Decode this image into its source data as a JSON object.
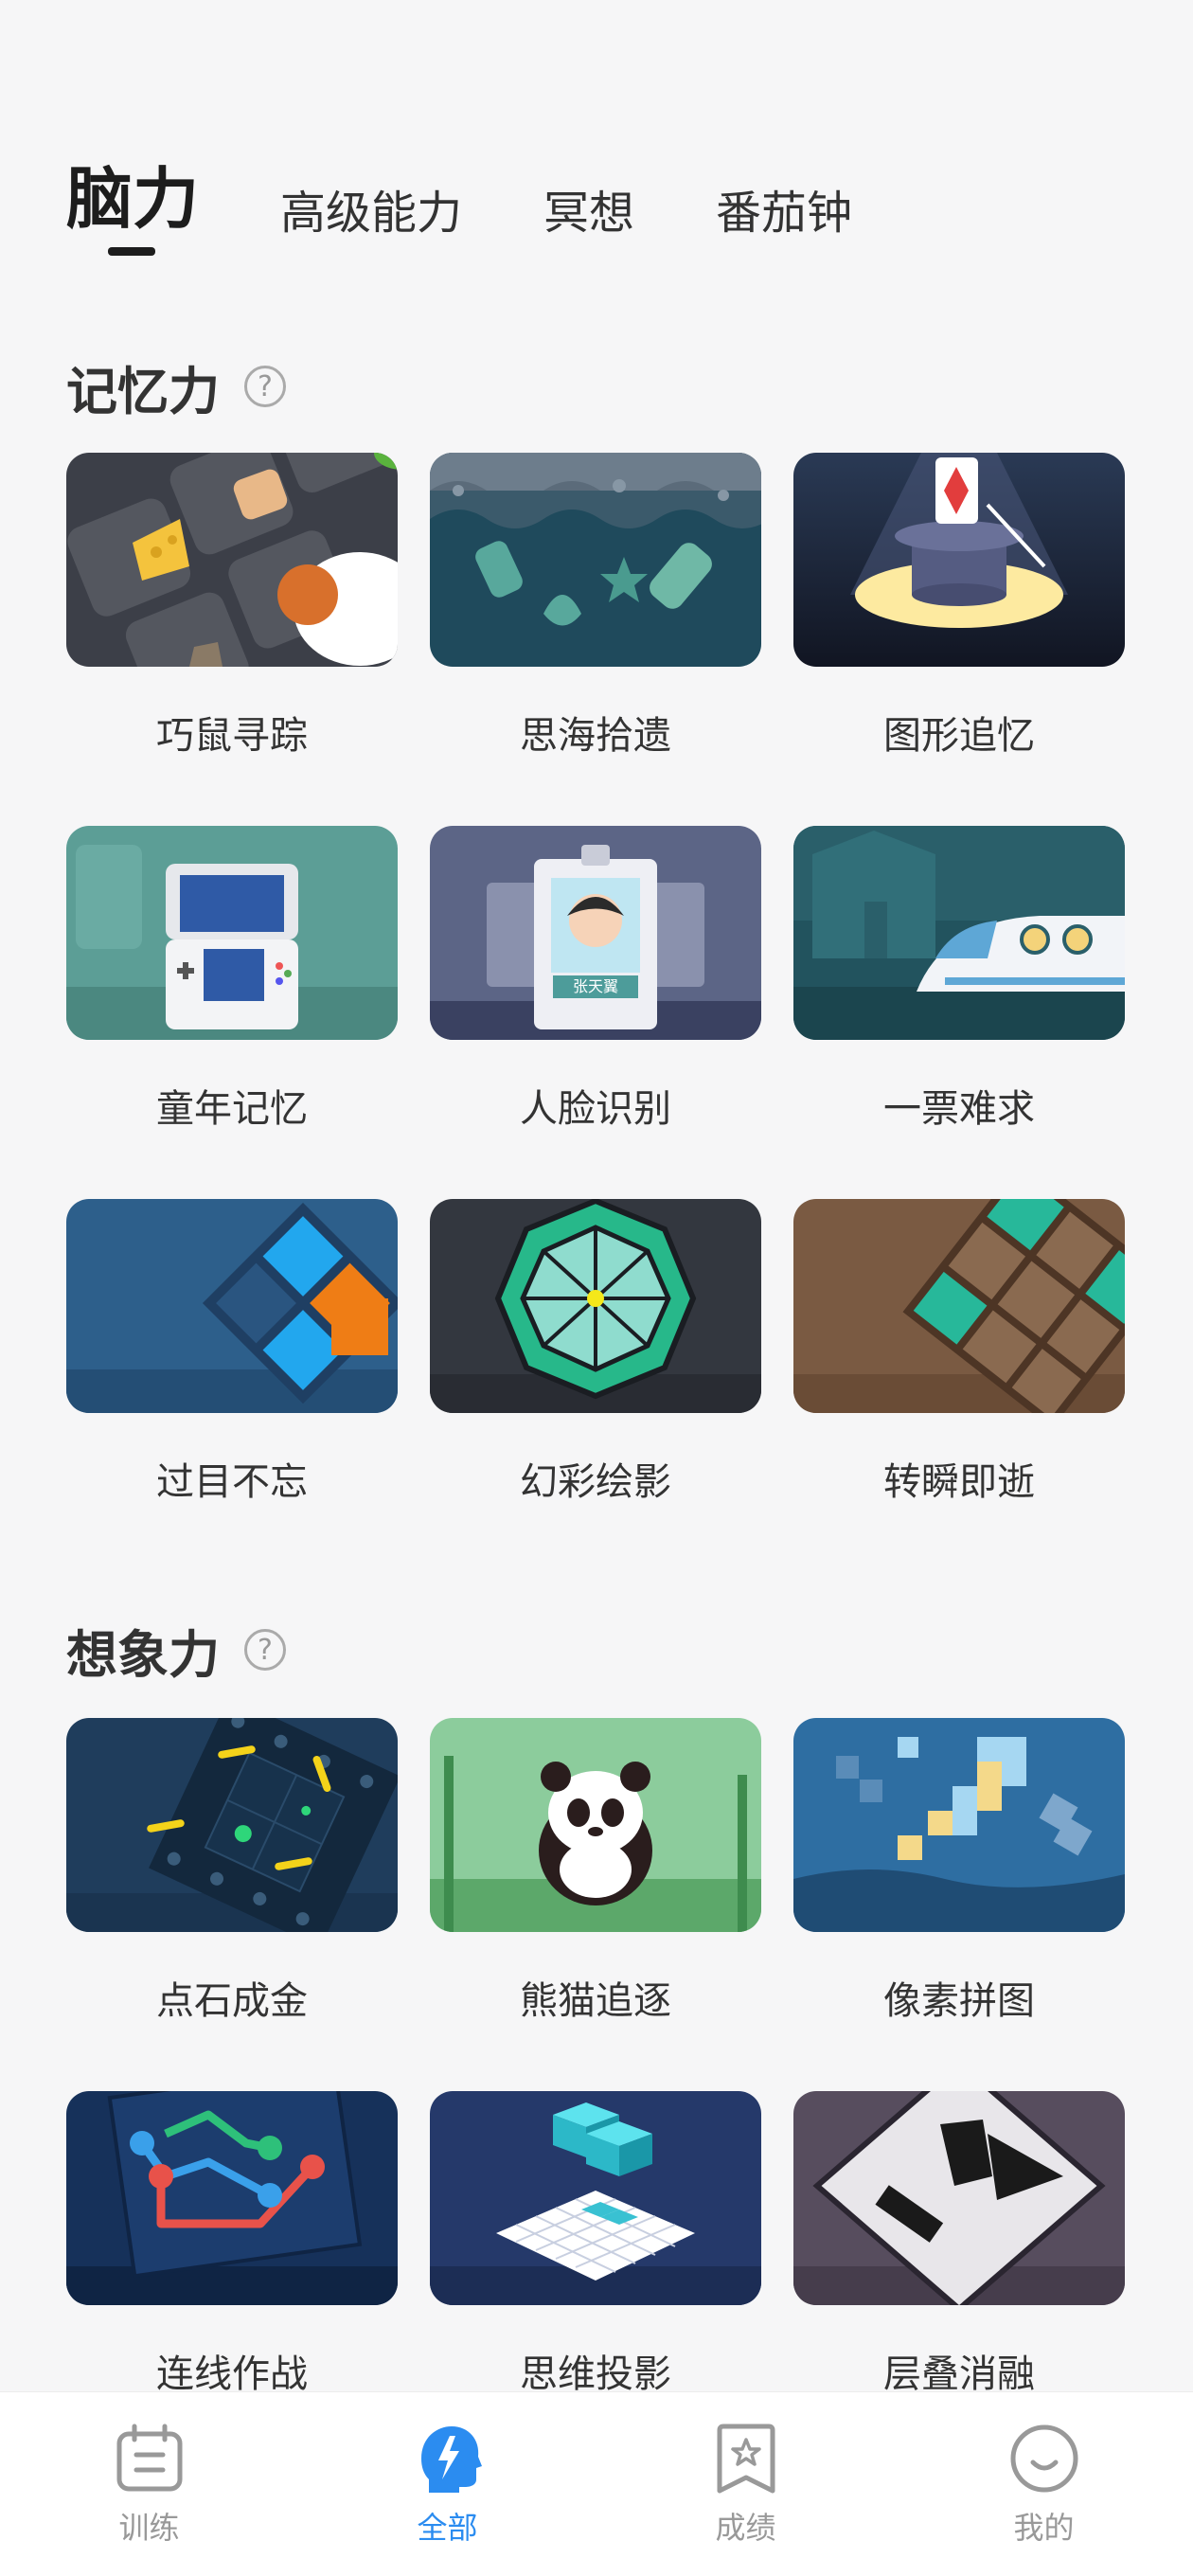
{
  "tabs": [
    {
      "label": "脑力",
      "active": true
    },
    {
      "label": "高级能力",
      "active": false
    },
    {
      "label": "冥想",
      "active": false
    },
    {
      "label": "番茄钟",
      "active": false
    }
  ],
  "sections": [
    {
      "title": "记忆力",
      "games": [
        {
          "label": "巧鼠寻踪",
          "icon": "mouse-cheese-thumb"
        },
        {
          "label": "思海拾遗",
          "icon": "sea-items-thumb"
        },
        {
          "label": "图形追忆",
          "icon": "magic-hat-thumb"
        },
        {
          "label": "童年记忆",
          "icon": "handheld-console-thumb"
        },
        {
          "label": "人脸识别",
          "icon": "face-id-thumb",
          "badge_text": "张天翼"
        },
        {
          "label": "一票难求",
          "icon": "train-thumb"
        },
        {
          "label": "过目不忘",
          "icon": "blue-squares-thumb"
        },
        {
          "label": "幻彩绘影",
          "icon": "green-gem-thumb"
        },
        {
          "label": "转瞬即逝",
          "icon": "tile-board-thumb"
        }
      ]
    },
    {
      "title": "想象力",
      "games": [
        {
          "label": "点石成金",
          "icon": "dot-grid-thumb"
        },
        {
          "label": "熊猫追逐",
          "icon": "panda-thumb"
        },
        {
          "label": "像素拼图",
          "icon": "pixel-puzzle-thumb"
        },
        {
          "label": "连线作战",
          "icon": "connect-lines-thumb"
        },
        {
          "label": "思维投影",
          "icon": "projection-cubes-thumb"
        },
        {
          "label": "层叠消融",
          "icon": "layer-shapes-thumb"
        }
      ]
    }
  ],
  "bottom_nav": [
    {
      "label": "训练",
      "icon": "calendar-icon",
      "active": false
    },
    {
      "label": "全部",
      "icon": "brain-head-icon",
      "active": true
    },
    {
      "label": "成绩",
      "icon": "star-bookmark-icon",
      "active": false
    },
    {
      "label": "我的",
      "icon": "smile-face-icon",
      "active": false
    }
  ],
  "colors": {
    "accent": "#2b8cf0",
    "text": "#333333",
    "background": "#f6f6f7"
  }
}
